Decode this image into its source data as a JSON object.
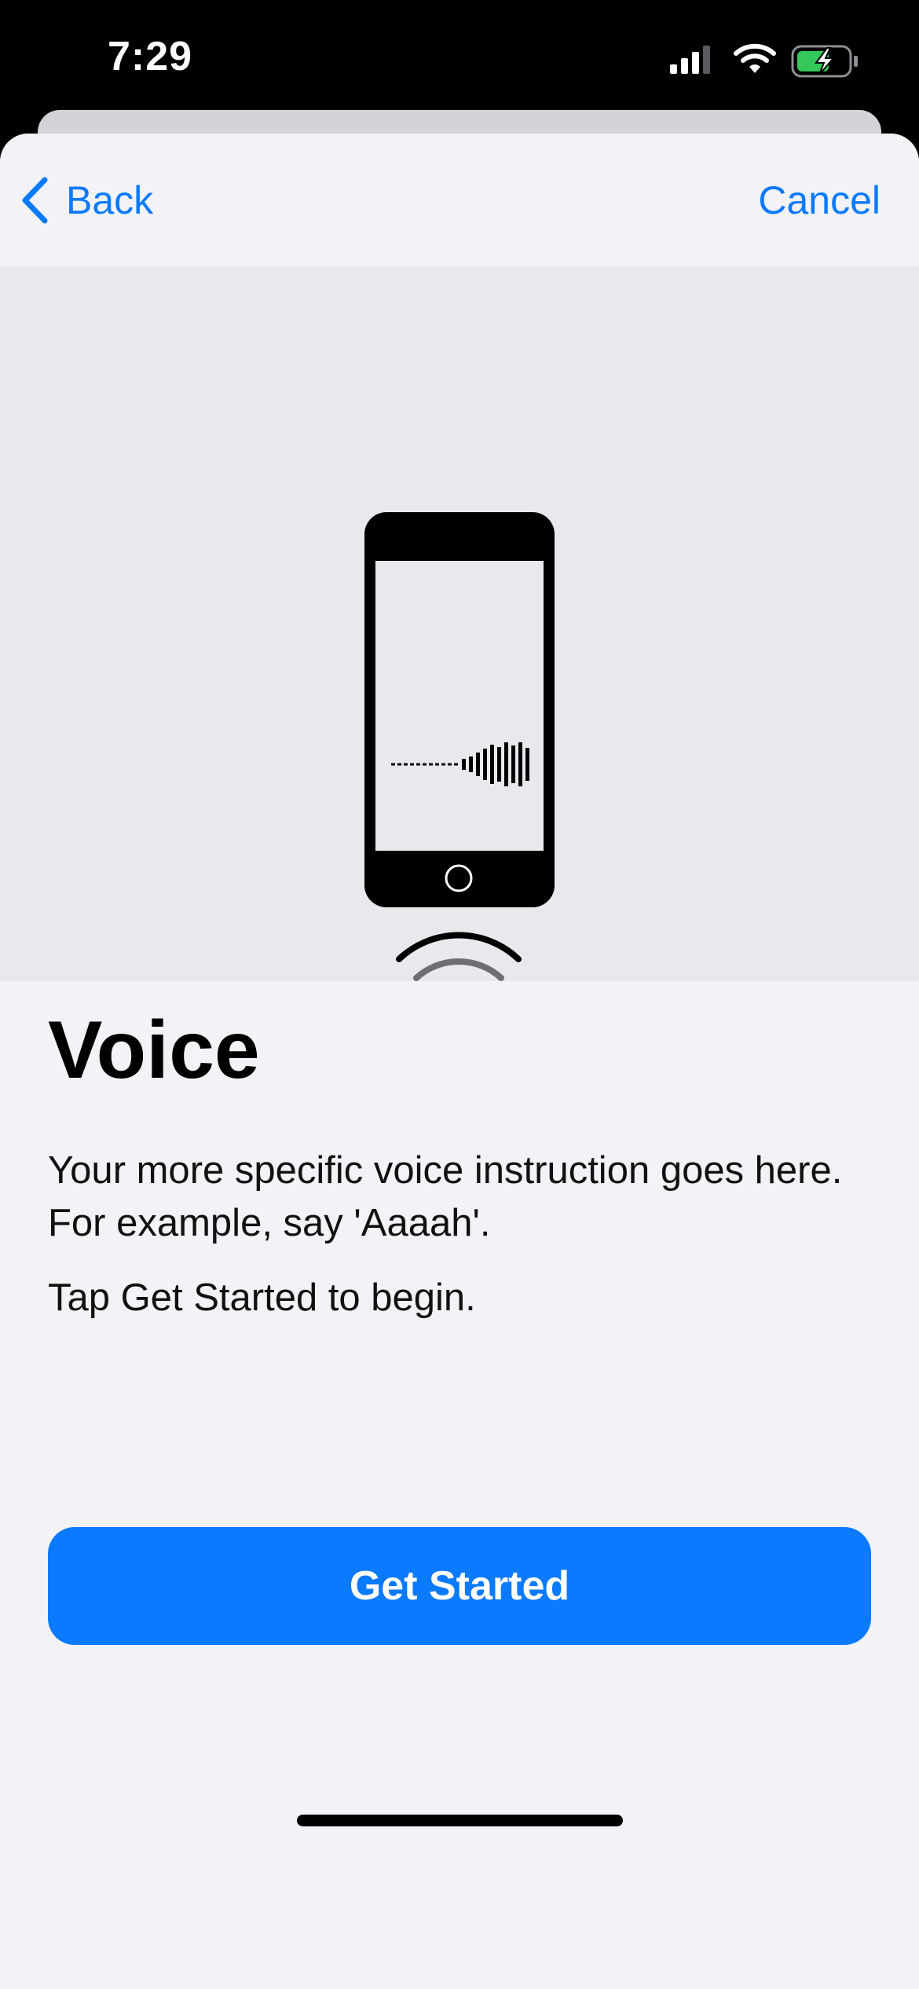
{
  "status_bar": {
    "time": "7:29",
    "icons": [
      "cellular-signal-icon",
      "wifi-icon",
      "battery-charging-icon"
    ],
    "battery_color": "#34c759"
  },
  "nav": {
    "back_label": "Back",
    "cancel_label": "Cancel",
    "back_icon": "chevron-left-icon"
  },
  "illustration": {
    "icons": [
      "phone-icon",
      "waveform-icon",
      "home-button-icon",
      "sound-waves-icon"
    ]
  },
  "main": {
    "title": "Voice",
    "instruction": "Your more specific voice instruction goes here. For example, say 'Aaaah'.",
    "hint": "Tap Get Started to begin."
  },
  "actions": {
    "get_started_label": "Get Started"
  },
  "colors": {
    "accent": "#0a7aff",
    "background": "#f2f2f7",
    "illustration_background": "#e8e8ed"
  }
}
